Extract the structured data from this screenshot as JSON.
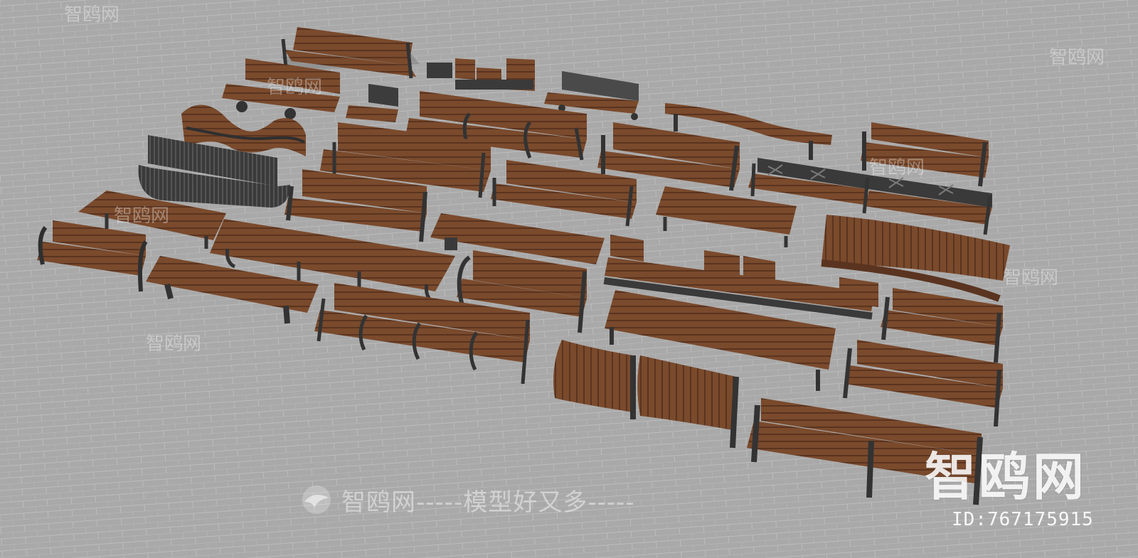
{
  "image": {
    "subject": "collection-of-park-benches-3d-render",
    "ground_color": "#a7a7a7",
    "wood_color": "#7a4a2c",
    "metal_color": "#3b3b3b"
  },
  "watermarks": {
    "center_text": "智鸥网-----模型好又多-----",
    "brand_big": "智鸥网",
    "id_text": "ID:767175915",
    "small_brand": "智鸥网"
  }
}
